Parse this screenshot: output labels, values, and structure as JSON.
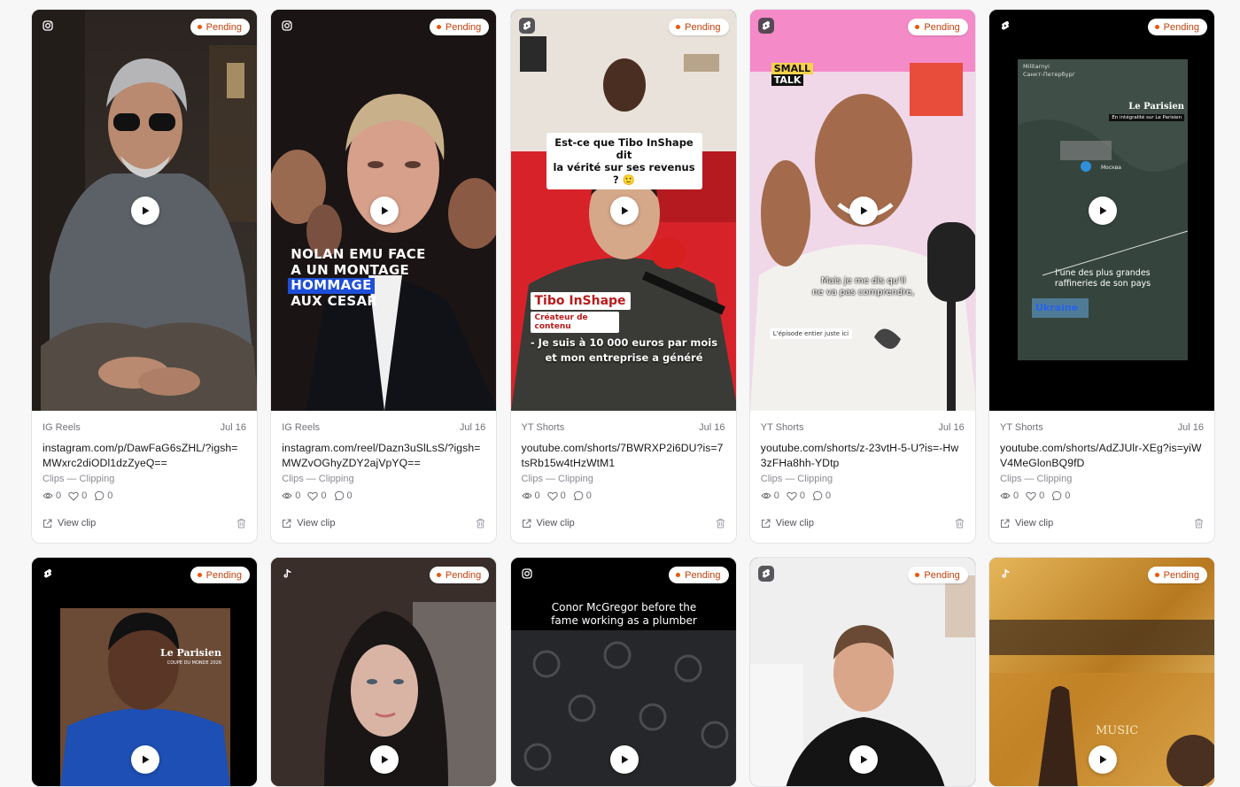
{
  "badge_label": "Pending",
  "view_clip_label": "View clip",
  "colors": {
    "pending_text": "#c2410c",
    "pending_dot": "#ea580c"
  },
  "cards": [
    {
      "platform_icon": "instagram-icon",
      "platform": "IG Reels",
      "date": "Jul 16",
      "url": "instagram.com/p/DawFaG6sZHL/?igsh=MWxrc2diODl1dzZyeQ==",
      "campaign": "Clips — Clipping",
      "views": "0",
      "likes": "0",
      "comments": "0"
    },
    {
      "platform_icon": "instagram-icon",
      "platform": "IG Reels",
      "date": "Jul 16",
      "url": "instagram.com/reel/Dazn3uSlLsS/?igsh=MWZvOGhyZDY2ajVpYQ==",
      "campaign": "Clips — Clipping",
      "views": "0",
      "likes": "0",
      "comments": "0",
      "overlay": [
        "NOLAN EMU FACE",
        "A UN MONTAGE",
        "HOMMAGE",
        "AUX CESAR"
      ]
    },
    {
      "platform_icon": "youtube-shorts-icon",
      "platform": "YT Shorts",
      "date": "Jul 16",
      "url": "youtube.com/shorts/7BWRXP2i6DU?is=7tsRb15w4tHzWtM1",
      "campaign": "Clips — Clipping",
      "views": "0",
      "likes": "0",
      "comments": "0",
      "overlay": [
        "Est-ce que Tibo InShape dit",
        "la vérité sur ses revenus ? 🙂",
        "Tibo InShape",
        "Créateur de contenu",
        "- Je suis à 10 000 euros par mois",
        "et mon entreprise a généré"
      ]
    },
    {
      "platform_icon": "youtube-shorts-icon",
      "platform": "YT Shorts",
      "date": "Jul 16",
      "url": "youtube.com/shorts/z-23vtH-5-U?is=-Hw3zFHa8hh-YDtp",
      "campaign": "Clips — Clipping",
      "views": "0",
      "likes": "0",
      "comments": "0",
      "overlay": [
        "SMALL",
        "TALK",
        "Mais je me dis qu'il",
        "ne va pas comprendre,",
        "L'épisode entier juste ici"
      ]
    },
    {
      "platform_icon": "youtube-shorts-icon",
      "platform": "YT Shorts",
      "date": "Jul 16",
      "url": "youtube.com/shorts/AdZJUlr-XEg?is=yiWV4MeGlonBQ9fD",
      "campaign": "Clips — Clipping",
      "views": "0",
      "likes": "0",
      "comments": "0",
      "overlay": [
        "Militarnyi",
        "Санкт-Петербург",
        "Le Parisien",
        "En intégralité sur Le Parisien",
        "Москва",
        "l'une des plus grandes",
        "raffineries de son pays",
        "Ukraine"
      ]
    },
    {
      "platform_icon": "youtube-shorts-icon",
      "overlay": [
        "Le Parisien",
        "COUPE DU MONDE 2026"
      ]
    },
    {
      "platform_icon": "tiktok-icon"
    },
    {
      "platform_icon": "instagram-icon",
      "overlay": [
        "Conor McGregor before the",
        "fame working as a plumber"
      ]
    },
    {
      "platform_icon": "youtube-shorts-icon"
    },
    {
      "platform_icon": "tiktok-icon",
      "overlay": [
        "MUSIC"
      ]
    }
  ]
}
